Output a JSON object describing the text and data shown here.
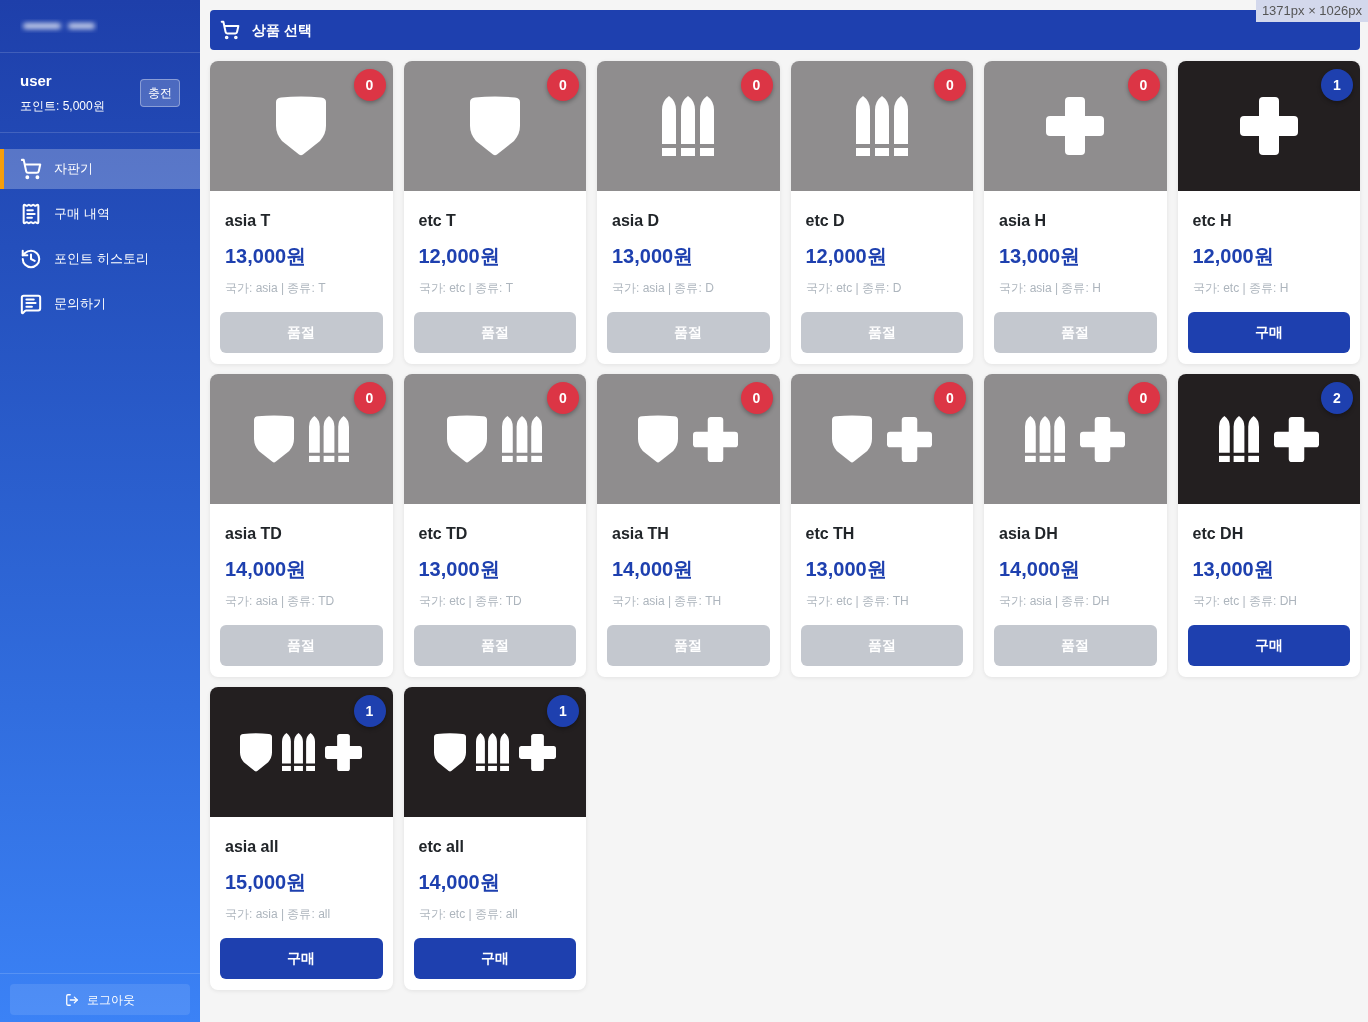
{
  "sidebar": {
    "user": {
      "name": "user",
      "points": "포인트: 5,000원",
      "charge_button": "충전"
    },
    "nav": [
      {
        "label": "자판기",
        "kind": "cart",
        "selected": true
      },
      {
        "label": "구매 내역",
        "kind": "receipt",
        "selected": false
      },
      {
        "label": "포인트 히스토리",
        "kind": "history",
        "selected": false
      },
      {
        "label": "문의하기",
        "kind": "chat",
        "selected": false
      }
    ],
    "logout": "로그아웃"
  },
  "header": {
    "title": "상품 선택"
  },
  "products": [
    {
      "name": "asia T",
      "price": "13,000원",
      "info": "국가: asia | 종류: T",
      "stock": "0",
      "sold_out": true,
      "button": "품절",
      "contents": [
        {
          "kind": "shield"
        }
      ]
    },
    {
      "name": "etc T",
      "price": "12,000원",
      "info": "국가: etc | 종류: T",
      "stock": "0",
      "sold_out": true,
      "button": "품절",
      "contents": [
        {
          "kind": "shield"
        }
      ]
    },
    {
      "name": "asia D",
      "price": "13,000원",
      "info": "국가: asia | 종류: D",
      "stock": "0",
      "sold_out": true,
      "button": "품절",
      "contents": [
        {
          "kind": "bullets"
        }
      ]
    },
    {
      "name": "etc D",
      "price": "12,000원",
      "info": "국가: etc | 종류: D",
      "stock": "0",
      "sold_out": true,
      "button": "품절",
      "contents": [
        {
          "kind": "bullets"
        }
      ]
    },
    {
      "name": "asia H",
      "price": "13,000원",
      "info": "국가: asia | 종류: H",
      "stock": "0",
      "sold_out": true,
      "button": "품절",
      "contents": [
        {
          "kind": "cross"
        }
      ]
    },
    {
      "name": "etc H",
      "price": "12,000원",
      "info": "국가: etc | 종류: H",
      "stock": "1",
      "sold_out": false,
      "button": "구매",
      "contents": [
        {
          "kind": "cross"
        }
      ]
    },
    {
      "name": "asia TD",
      "price": "14,000원",
      "info": "국가: asia | 종류: TD",
      "stock": "0",
      "sold_out": true,
      "button": "품절",
      "contents": [
        {
          "kind": "shield"
        },
        {
          "kind": "bullets"
        }
      ]
    },
    {
      "name": "etc TD",
      "price": "13,000원",
      "info": "국가: etc | 종류: TD",
      "stock": "0",
      "sold_out": true,
      "button": "품절",
      "contents": [
        {
          "kind": "shield"
        },
        {
          "kind": "bullets"
        }
      ]
    },
    {
      "name": "asia TH",
      "price": "14,000원",
      "info": "국가: asia | 종류: TH",
      "stock": "0",
      "sold_out": true,
      "button": "품절",
      "contents": [
        {
          "kind": "shield"
        },
        {
          "kind": "cross"
        }
      ]
    },
    {
      "name": "etc TH",
      "price": "13,000원",
      "info": "국가: etc | 종류: TH",
      "stock": "0",
      "sold_out": true,
      "button": "품절",
      "contents": [
        {
          "kind": "shield"
        },
        {
          "kind": "cross"
        }
      ]
    },
    {
      "name": "asia DH",
      "price": "14,000원",
      "info": "국가: asia | 종류: DH",
      "stock": "0",
      "sold_out": true,
      "button": "품절",
      "contents": [
        {
          "kind": "bullets"
        },
        {
          "kind": "cross"
        }
      ]
    },
    {
      "name": "etc DH",
      "price": "13,000원",
      "info": "국가: etc | 종류: DH",
      "stock": "2",
      "sold_out": false,
      "button": "구매",
      "contents": [
        {
          "kind": "bullets"
        },
        {
          "kind": "cross"
        }
      ]
    },
    {
      "name": "asia all",
      "price": "15,000원",
      "info": "국가: asia | 종류: all",
      "stock": "1",
      "sold_out": false,
      "button": "구매",
      "contents": [
        {
          "kind": "shield"
        },
        {
          "kind": "bullets"
        },
        {
          "kind": "cross"
        }
      ]
    },
    {
      "name": "etc all",
      "price": "14,000원",
      "info": "국가: etc | 종류: all",
      "stock": "1",
      "sold_out": false,
      "button": "구매",
      "contents": [
        {
          "kind": "shield"
        },
        {
          "kind": "bullets"
        },
        {
          "kind": "cross"
        }
      ]
    }
  ],
  "size_overlay": "1371px × 1026px"
}
